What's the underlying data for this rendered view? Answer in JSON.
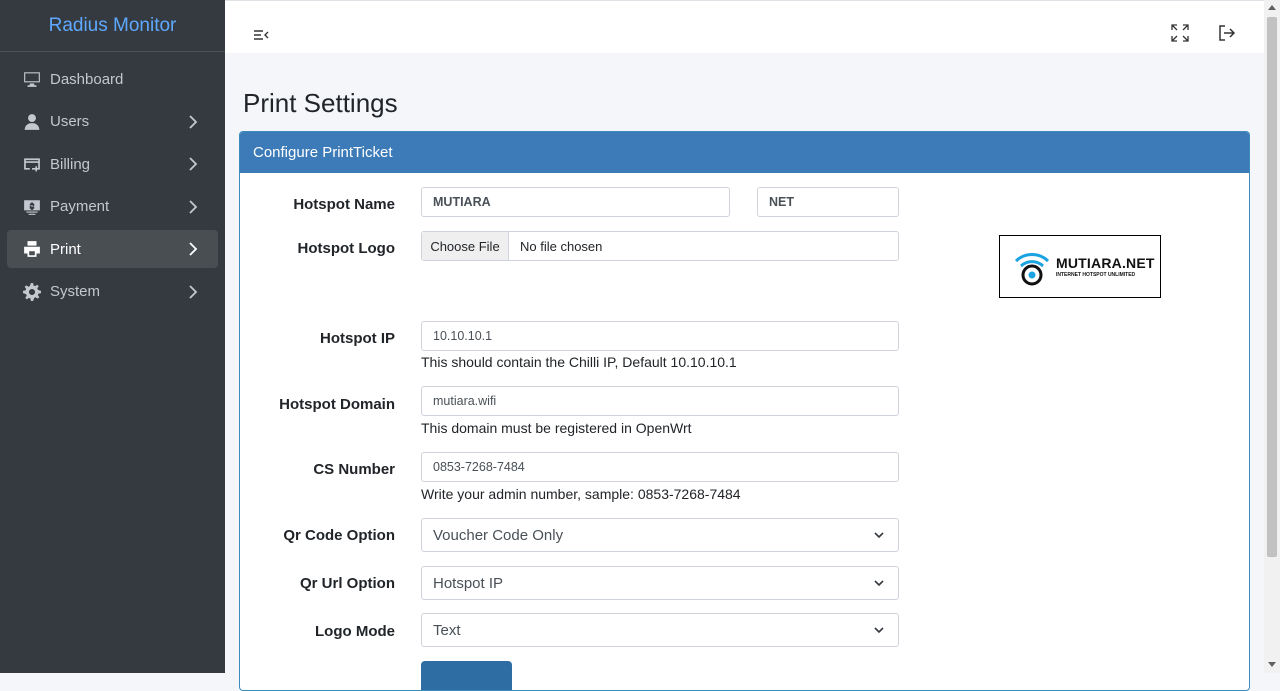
{
  "app": {
    "brand": "Radius Monitor"
  },
  "sidebar": {
    "items": [
      {
        "label": "Dashboard",
        "icon": "desktop-icon"
      },
      {
        "label": "Users",
        "icon": "user-icon"
      },
      {
        "label": "Billing",
        "icon": "billing-icon"
      },
      {
        "label": "Payment",
        "icon": "money-icon"
      },
      {
        "label": "Print",
        "icon": "print-icon",
        "active": true
      },
      {
        "label": "System",
        "icon": "gear-icon"
      }
    ]
  },
  "topbar": {
    "menu_icon": "menu-collapse-icon",
    "fullscreen_icon": "fullscreen-icon",
    "logout_icon": "logout-icon"
  },
  "page": {
    "title": "Print Settings"
  },
  "card": {
    "header": "Configure PrintTicket",
    "hotspot_name": {
      "label": "Hotspot Name",
      "value1": "MUTIARA",
      "value2": "NET"
    },
    "hotspot_logo": {
      "label": "Hotspot Logo",
      "button": "Choose File",
      "status": "No file chosen"
    },
    "logo_preview": {
      "main": "MUTIARA.NET",
      "sub": "INTERNET HOTSPOT UNLIMITED"
    },
    "hotspot_ip": {
      "label": "Hotspot IP",
      "value": "10.10.10.1",
      "help": "This should contain the Chilli IP, Default 10.10.10.1"
    },
    "hotspot_domain": {
      "label": "Hotspot Domain",
      "value": "mutiara.wifi",
      "help": "This domain must be registered in OpenWrt"
    },
    "cs_number": {
      "label": "CS Number",
      "value": "0853-7268-7484",
      "help": "Write your admin number, sample: 0853-7268-7484"
    },
    "qr_code_option": {
      "label": "Qr Code Option",
      "value": "Voucher Code Only"
    },
    "qr_url_option": {
      "label": "Qr Url Option",
      "value": "Hotspot IP"
    },
    "logo_mode": {
      "label": "Logo Mode",
      "value": "Text"
    }
  },
  "colors": {
    "sidebar": "#343a40",
    "accent": "#3c7bb8",
    "brand": "#5fa8ff"
  }
}
